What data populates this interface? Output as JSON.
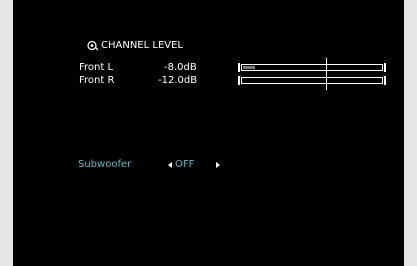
{
  "header": {
    "title": "CHANNEL LEVEL",
    "icon": "speaker-settings-icon"
  },
  "channels": [
    {
      "name": "Front L",
      "level": "-8.0dB",
      "fill_fraction": 0.09
    },
    {
      "name": "Front R",
      "level": "-12.0dB",
      "fill_fraction": 0.0
    }
  ],
  "subwoofer": {
    "label": "Subwoofer",
    "value": "OFF"
  },
  "colors": {
    "background": "#000000",
    "text": "#ffffff",
    "highlight": "#59b8c4"
  }
}
